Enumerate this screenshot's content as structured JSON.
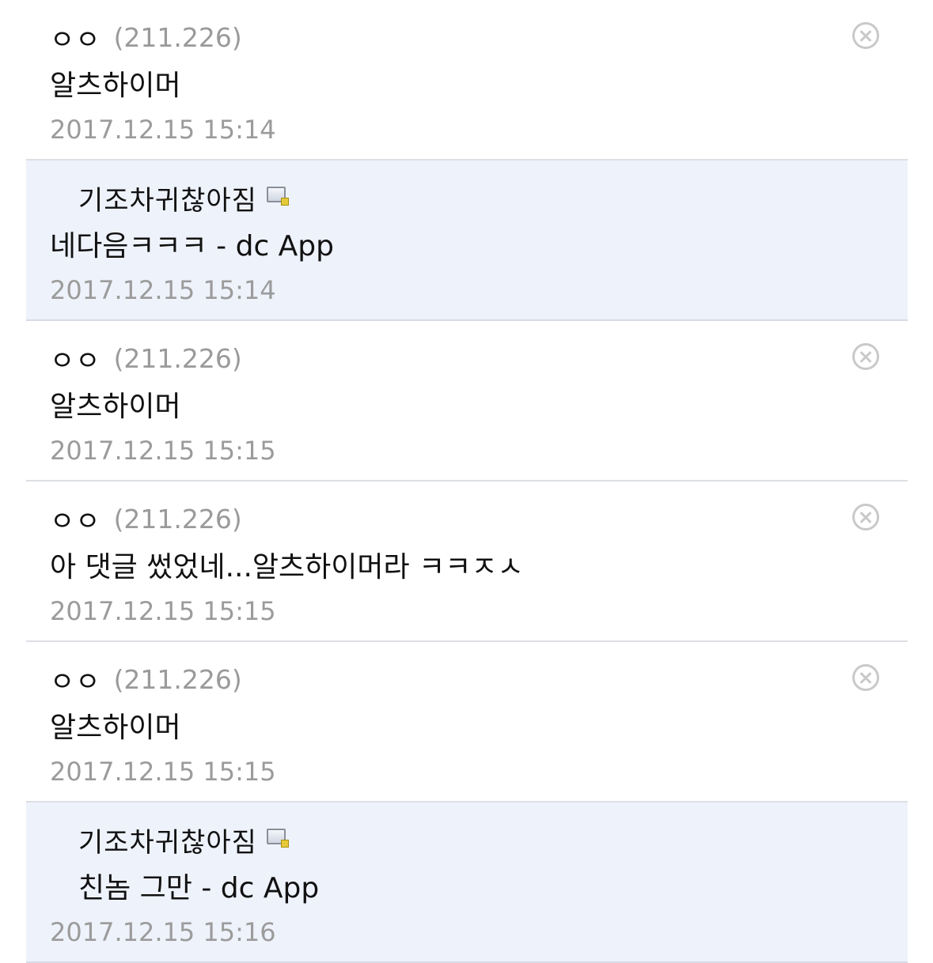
{
  "comments": [
    {
      "type": "comment",
      "nickname": "ㅇㅇ",
      "ip": "(211.226)",
      "text": "알츠하이머",
      "timestamp": "2017.12.15 15:14",
      "delete_icon": "close-circle-icon"
    },
    {
      "type": "reply",
      "nickname": "기조차귀찮아짐",
      "member_icon": "fixed-nick-icon",
      "text": "네다음ㅋㅋㅋ - dc App",
      "timestamp": "2017.12.15 15:14"
    },
    {
      "type": "comment",
      "nickname": "ㅇㅇ",
      "ip": "(211.226)",
      "text": "알츠하이머",
      "timestamp": "2017.12.15 15:15",
      "delete_icon": "close-circle-icon"
    },
    {
      "type": "comment",
      "nickname": "ㅇㅇ",
      "ip": "(211.226)",
      "text": "아 댓글 썼었네...알츠하이머라 ㅋㅋㅈㅅ",
      "timestamp": "2017.12.15 15:15",
      "delete_icon": "close-circle-icon"
    },
    {
      "type": "comment",
      "nickname": "ㅇㅇ",
      "ip": "(211.226)",
      "text": "알츠하이머",
      "timestamp": "2017.12.15 15:15",
      "delete_icon": "close-circle-icon"
    },
    {
      "type": "reply",
      "nickname": "기조차귀찮아짐",
      "member_icon": "fixed-nick-icon",
      "text": "친놈 그만 - dc App",
      "timestamp": "2017.12.15 15:16"
    }
  ],
  "colors": {
    "reply_background": "#eef2fb",
    "divider": "#dcdfe4",
    "text": "#111111",
    "meta_text": "#9b9b9b",
    "delete_icon": "#c9c9c9"
  }
}
